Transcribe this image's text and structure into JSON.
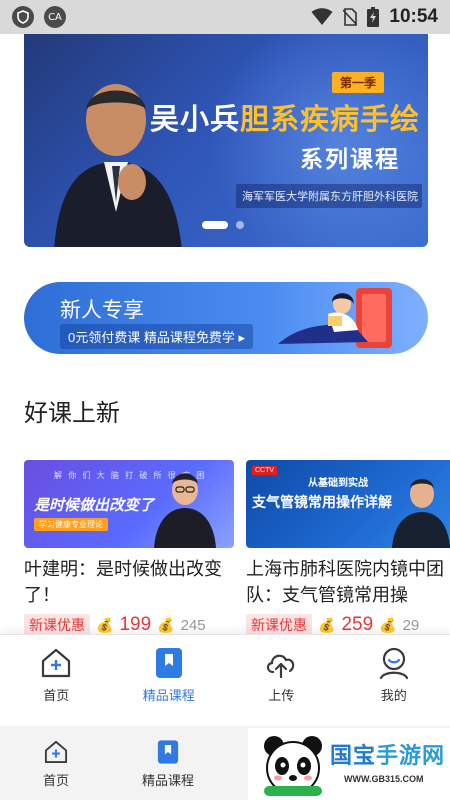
{
  "status_bar": {
    "left_icons": [
      "shield-icon",
      "ca-icon"
    ],
    "ca_label": "CA",
    "time": "10:54"
  },
  "banner": {
    "season_tag": "第一季",
    "title_name": "吴小兵",
    "title_topic": "胆系疾病手绘",
    "subtitle": "系列课程",
    "hospital": "海军军医大学附属东方肝胆外科医院",
    "slides": 2,
    "active_slide": 1
  },
  "promo": {
    "title": "新人专享",
    "subtitle": "0元领付费课  精品课程免费学 ▸"
  },
  "section": {
    "title": "好课上新"
  },
  "courses": [
    {
      "thumb_small": "解 你 们 大 脑 打 破 所 很 疾 困",
      "thumb_text": "是时候做出改变了",
      "thumb_button": "学习健康专业理论",
      "title": "叶建明：是时候做出改变了！",
      "tag": "新课优惠",
      "price": "199",
      "original_price": "245",
      "coin_icon": "coin-icon"
    },
    {
      "thumb_chip": "CCTV",
      "thumb_tag": "从基础到实战",
      "thumb_text": "支气管镜常用操作详解",
      "title": "上海市肺科医院内镜中团队：支气管镜常用操",
      "tag": "新课优惠",
      "price": "259",
      "original_price": "29",
      "coin_icon": "coin-icon"
    }
  ],
  "tabbar": {
    "tabs": [
      {
        "label": "首页",
        "icon": "home-icon",
        "active": false
      },
      {
        "label": "精品课程",
        "icon": "bookmark-icon",
        "active": true
      },
      {
        "label": "上传",
        "icon": "cloud-upload-icon",
        "active": false
      },
      {
        "label": "我的",
        "icon": "user-icon",
        "active": false
      }
    ]
  },
  "tabbar_ghost": {
    "tabs": [
      {
        "label": "首页",
        "icon": "home-icon"
      },
      {
        "label": "精品课程",
        "icon": "bookmark-icon"
      }
    ]
  },
  "watermark": {
    "text_left": "国宝",
    "text_right": "手游网",
    "url": "WWW.GB315.COM"
  },
  "colors": {
    "accent": "#2d7be3",
    "price_red": "#e23a3a",
    "banner_gold": "#ffc12b"
  }
}
